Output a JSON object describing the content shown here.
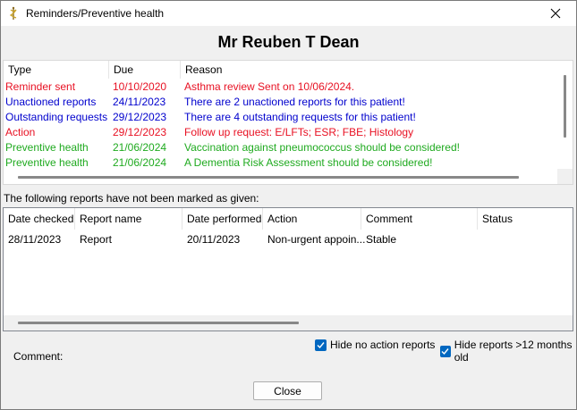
{
  "window": {
    "title": "Reminders/Preventive health"
  },
  "patient": {
    "name": "Mr Reuben T Dean"
  },
  "reminders": {
    "columns": [
      "Type",
      "Due",
      "Reason"
    ],
    "rows": [
      {
        "type": "Reminder sent",
        "due": "10/10/2020",
        "reason": "Asthma review    Sent on 10/06/2024.",
        "color": "#e81123"
      },
      {
        "type": "Unactioned reports",
        "due": "24/11/2023",
        "reason": "There are 2 unactioned reports for this patient!",
        "color": "#0000cd"
      },
      {
        "type": "Outstanding requests",
        "due": "29/12/2023",
        "reason": "There are 4 outstanding requests for this patient!",
        "color": "#0000cd"
      },
      {
        "type": "Action",
        "due": "29/12/2023",
        "reason": "Follow up request: E/LFTs; ESR; FBE; Histology",
        "color": "#e81123"
      },
      {
        "type": "Preventive health",
        "due": "21/06/2024",
        "reason": "Vaccination against pneumococcus should be considered!",
        "color": "#1faa1f"
      },
      {
        "type": "Preventive health",
        "due": "21/06/2024",
        "reason": "A Dementia Risk Assessment should be considered!",
        "color": "#1faa1f"
      }
    ]
  },
  "reports_section": {
    "label": "The following reports have not been marked as given:",
    "columns": [
      "Date checked",
      "Report name",
      "Date performed",
      "Action",
      "Comment",
      "Status"
    ],
    "rows": [
      {
        "date_checked": "28/11/2023",
        "report_name": "Report",
        "date_performed": "20/11/2023",
        "action": "Non-urgent appoin...",
        "comment": "Stable",
        "status": ""
      }
    ]
  },
  "options": {
    "hide_no_action": {
      "label": "Hide no action reports",
      "checked": true
    },
    "hide_old": {
      "label": "Hide reports >12 months old",
      "checked": true
    }
  },
  "comment": {
    "label": "Comment:"
  },
  "close_button": {
    "label": "Close"
  },
  "icons": {
    "app": "caduceus-icon",
    "close": "close-icon",
    "check": "check-icon"
  },
  "colors": {
    "checkbox": "#0067c0",
    "red": "#e81123",
    "blue": "#0000cd",
    "green": "#1faa1f"
  }
}
